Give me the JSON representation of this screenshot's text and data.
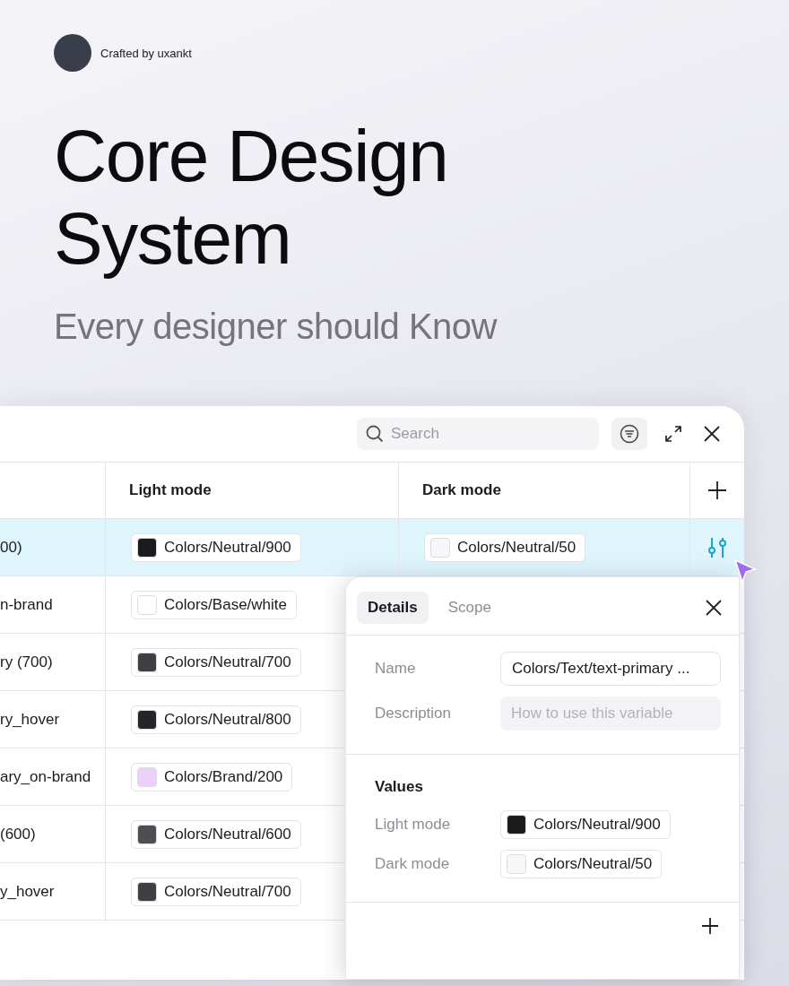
{
  "author": {
    "credit": "Crafted by uxankt"
  },
  "headline": {
    "title": "Core Design System",
    "subtitle": "Every designer should Know"
  },
  "variables_window": {
    "search": {
      "placeholder": "Search"
    },
    "columns": [
      {
        "label": "Light mode"
      },
      {
        "label": "Dark mode"
      }
    ],
    "rows": [
      {
        "name": "00)",
        "selected": true,
        "light": {
          "label": "Colors/Neutral/900",
          "color": "#1b1a1d"
        },
        "dark": {
          "label": "Colors/Neutral/50",
          "color": "#f7f6f8"
        }
      },
      {
        "name": "n-brand",
        "selected": false,
        "light": {
          "label": "Colors/Base/white",
          "color": "#ffffff"
        }
      },
      {
        "name": "ry (700)",
        "selected": false,
        "light": {
          "label": "Colors/Neutral/700",
          "color": "#3f3e42"
        }
      },
      {
        "name": "ry_hover",
        "selected": false,
        "light": {
          "label": "Colors/Neutral/800",
          "color": "#252428"
        }
      },
      {
        "name": "ary_on-brand",
        "selected": false,
        "light": {
          "label": "Colors/Brand/200",
          "color": "#ecd0fb"
        }
      },
      {
        "name": "(600)",
        "selected": false,
        "light": {
          "label": "Colors/Neutral/600",
          "color": "#4e4d52"
        }
      },
      {
        "name": "y_hover",
        "selected": false,
        "light": {
          "label": "Colors/Neutral/700",
          "color": "#3f3e42"
        }
      }
    ]
  },
  "details_popover": {
    "tabs": [
      {
        "label": "Details",
        "selected": true
      },
      {
        "label": "Scope",
        "selected": false
      }
    ],
    "fields": [
      {
        "kind": "value",
        "label": "Name",
        "value": "Colors/Text/text-primary ..."
      },
      {
        "kind": "placeholder",
        "label": "Description",
        "placeholder": "How to use this variable"
      }
    ],
    "values_heading": "Values",
    "values": [
      {
        "mode": "Light mode",
        "label": "Colors/Neutral/900",
        "color": "#1b1a1d"
      },
      {
        "mode": "Dark mode",
        "label": "Colors/Neutral/50",
        "color": "#f7f6f8"
      }
    ]
  }
}
